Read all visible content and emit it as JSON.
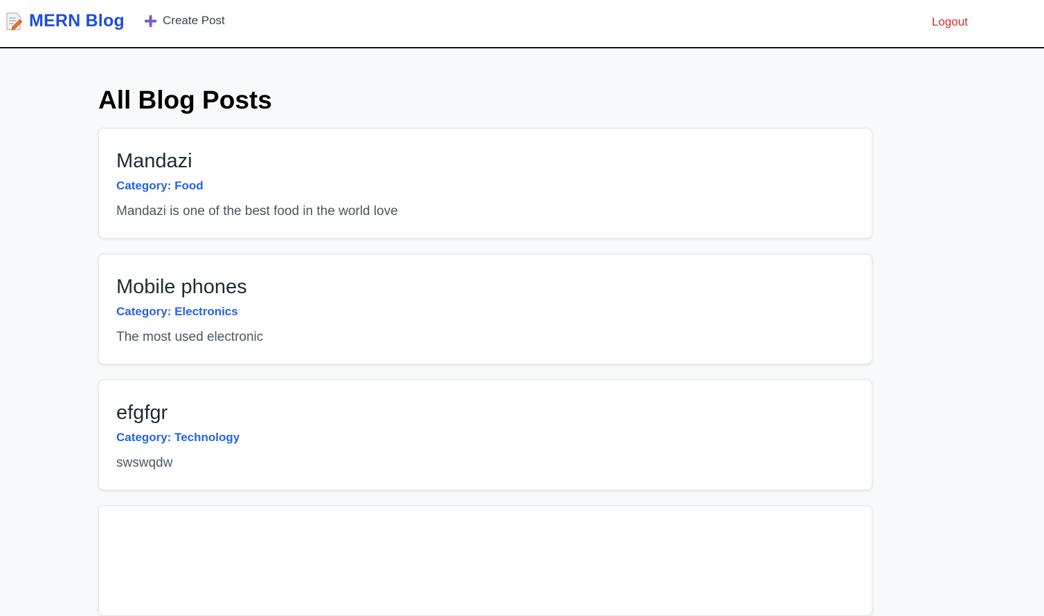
{
  "navbar": {
    "brand_title": "MERN Blog",
    "create_label": "Create Post",
    "logout_label": "Logout",
    "brand_color": "#1d4ed8",
    "logout_color": "#dc2626"
  },
  "main": {
    "page_title": "All Blog Posts",
    "posts": [
      {
        "title": "Mandazi",
        "category": "Category: Food",
        "content": "Mandazi is one of the best food in the world love"
      },
      {
        "title": "Mobile phones",
        "category": "Category: Electronics",
        "content": "The most used electronic"
      },
      {
        "title": "efgfgr",
        "category": "Category: Technology",
        "content": "swswqdw"
      }
    ]
  },
  "icons": {
    "brand": "memo-icon",
    "create": "plus-icon"
  }
}
